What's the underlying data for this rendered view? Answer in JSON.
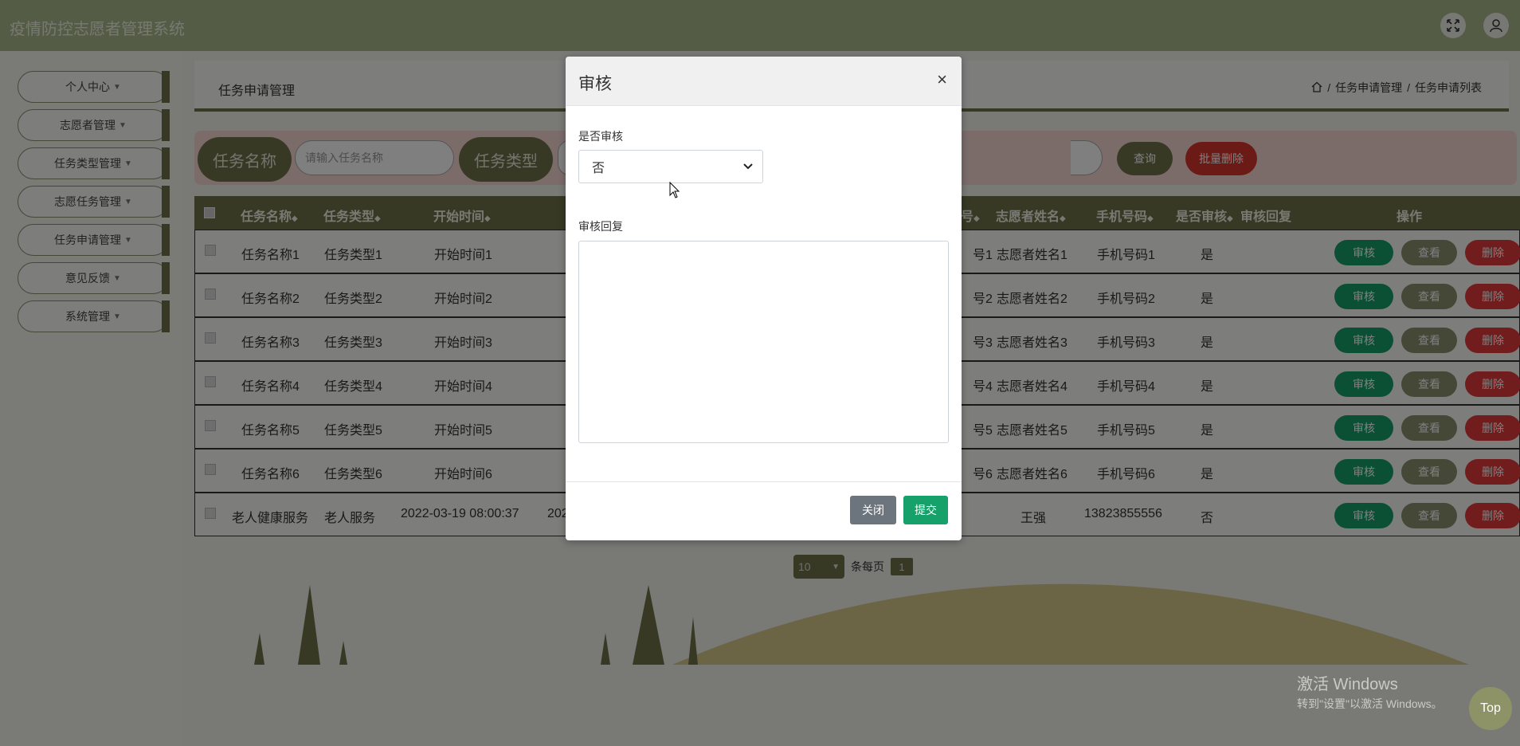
{
  "app": {
    "title": "疫情防控志愿者管理系统"
  },
  "header": {
    "fullscreen_icon": "expand-icon",
    "user_icon": "user-icon"
  },
  "sidebar": {
    "items": [
      {
        "label": "个人中心"
      },
      {
        "label": "志愿者管理"
      },
      {
        "label": "任务类型管理"
      },
      {
        "label": "志愿任务管理"
      },
      {
        "label": "任务申请管理"
      },
      {
        "label": "意见反馈"
      },
      {
        "label": "系统管理"
      }
    ]
  },
  "page": {
    "title": "任务申请管理",
    "breadcrumb": [
      "任务申请管理",
      "任务申请列表"
    ]
  },
  "search": {
    "task_name_label": "任务名称",
    "task_name_placeholder": "请输入任务名称",
    "task_type_label": "任务类型",
    "query_label": "查询",
    "batch_delete_label": "批量删除"
  },
  "table": {
    "headers": {
      "task_name": "任务名称",
      "task_type": "任务类型",
      "start_time": "开始时间",
      "number_fragment": "号",
      "volunteer_name": "志愿者姓名",
      "phone": "手机号码",
      "audited": "是否审核",
      "reply": "审核回复",
      "action": "操作"
    },
    "rows": [
      {
        "task_name": "任务名称1",
        "task_type": "任务类型1",
        "start_time": "开始时间1",
        "number_fragment": "号1",
        "volunteer_name": "志愿者姓名1",
        "phone": "手机号码1",
        "audited": "是"
      },
      {
        "task_name": "任务名称2",
        "task_type": "任务类型2",
        "start_time": "开始时间2",
        "number_fragment": "号2",
        "volunteer_name": "志愿者姓名2",
        "phone": "手机号码2",
        "audited": "是"
      },
      {
        "task_name": "任务名称3",
        "task_type": "任务类型3",
        "start_time": "开始时间3",
        "number_fragment": "号3",
        "volunteer_name": "志愿者姓名3",
        "phone": "手机号码3",
        "audited": "是"
      },
      {
        "task_name": "任务名称4",
        "task_type": "任务类型4",
        "start_time": "开始时间4",
        "number_fragment": "号4",
        "volunteer_name": "志愿者姓名4",
        "phone": "手机号码4",
        "audited": "是"
      },
      {
        "task_name": "任务名称5",
        "task_type": "任务类型5",
        "start_time": "开始时间5",
        "number_fragment": "号5",
        "volunteer_name": "志愿者姓名5",
        "phone": "手机号码5",
        "audited": "是"
      },
      {
        "task_name": "任务名称6",
        "task_type": "任务类型6",
        "start_time": "开始时间6",
        "number_fragment": "号6",
        "volunteer_name": "志愿者姓名6",
        "phone": "手机号码6",
        "audited": "是"
      },
      {
        "task_name": "老人健康服务",
        "task_type": "老人服务",
        "start_time": "2022-03-19 08:00:37",
        "extra_fragment": "202",
        "number_fragment": "",
        "volunteer_name": "王强",
        "phone": "13823855556",
        "audited": "否"
      }
    ],
    "actions": {
      "audit": "审核",
      "view": "查看",
      "delete": "删除"
    }
  },
  "pager": {
    "page_size": "10",
    "per_page_label": "条每页",
    "current_page": "1"
  },
  "modal": {
    "title": "审核",
    "close_symbol": "×",
    "audit_label": "是否审核",
    "audit_value": "否",
    "reply_label": "审核回复",
    "reply_value": "",
    "close_button": "关闭",
    "submit_button": "提交"
  },
  "watermark": {
    "line1": "激活 Windows",
    "line2": "转到\"设置\"以激活 Windows。"
  },
  "back_to_top": "Top",
  "colors": {
    "primary": "#6e7348",
    "header": "#a9b88c",
    "audit": "#16a06a",
    "danger": "#e23a3a"
  }
}
